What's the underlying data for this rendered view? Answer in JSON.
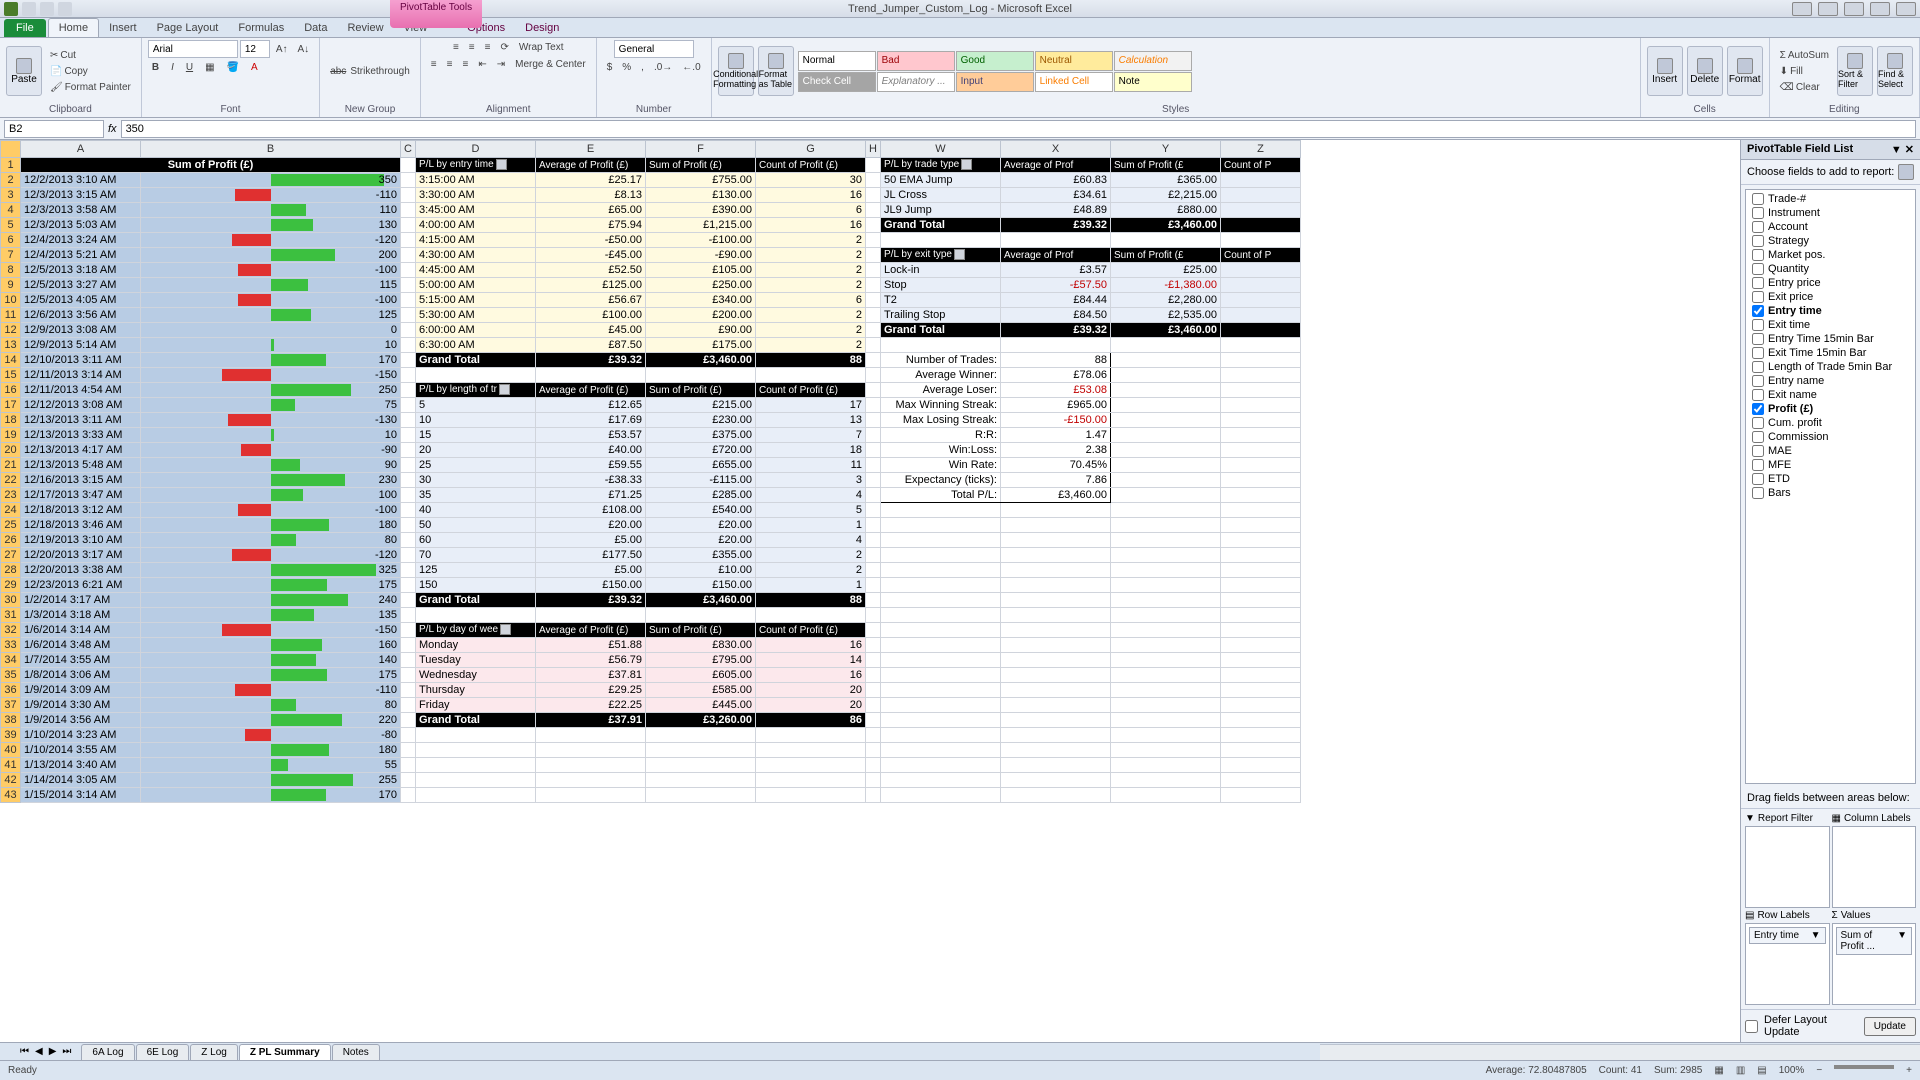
{
  "title": "Trend_Jumper_Custom_Log - Microsoft Excel",
  "tabtools": {
    "group": "PivotTable Tools",
    "designTab": "Design",
    "optionsTab": "Options"
  },
  "menu": {
    "file": "File",
    "home": "Home",
    "insert": "Insert",
    "pagelayout": "Page Layout",
    "formulas": "Formulas",
    "data": "Data",
    "review": "Review",
    "view": "View",
    "options": "Options",
    "design": "Design"
  },
  "ribbon": {
    "clipboard": {
      "label": "Clipboard",
      "paste": "Paste",
      "cut": "Cut",
      "copy": "Copy",
      "painter": "Format Painter"
    },
    "font": {
      "label": "Font",
      "name": "Arial",
      "size": "12"
    },
    "newgroup": {
      "label": "New Group",
      "strike": "Strikethrough"
    },
    "alignment": {
      "label": "Alignment",
      "wrap": "Wrap Text",
      "merge": "Merge & Center"
    },
    "number": {
      "label": "Number",
      "fmt": "General"
    },
    "styles": {
      "label": "Styles",
      "cond": "Conditional Formatting",
      "table": "Format as Table",
      "normal": "Normal",
      "bad": "Bad",
      "good": "Good",
      "neutral": "Neutral",
      "calc": "Calculation",
      "check": "Check Cell",
      "expl": "Explanatory ...",
      "input": "Input",
      "linked": "Linked Cell",
      "note": "Note"
    },
    "cells": {
      "label": "Cells",
      "insert": "Insert",
      "delete": "Delete",
      "format": "Format"
    },
    "editing": {
      "label": "Editing",
      "autosum": "AutoSum",
      "fill": "Fill",
      "clear": "Clear",
      "sort": "Sort & Filter",
      "find": "Find & Select"
    }
  },
  "nameBox": "B2",
  "formula": "350",
  "cols": [
    "A",
    "B",
    "C",
    "D",
    "E",
    "F",
    "G",
    "H",
    "W",
    "X",
    "Y",
    "Z"
  ],
  "sumProfitHeader": "Sum of Profit (£)",
  "profitRows": [
    {
      "r": 2,
      "date": "12/2/2013 3:10 AM",
      "v": 350
    },
    {
      "r": 3,
      "date": "12/3/2013 3:15 AM",
      "v": -110
    },
    {
      "r": 4,
      "date": "12/3/2013 3:58 AM",
      "v": 110
    },
    {
      "r": 5,
      "date": "12/3/2013 5:03 AM",
      "v": 130
    },
    {
      "r": 6,
      "date": "12/4/2013 3:24 AM",
      "v": -120
    },
    {
      "r": 7,
      "date": "12/4/2013 5:21 AM",
      "v": 200
    },
    {
      "r": 8,
      "date": "12/5/2013 3:18 AM",
      "v": -100
    },
    {
      "r": 9,
      "date": "12/5/2013 3:27 AM",
      "v": 115
    },
    {
      "r": 10,
      "date": "12/5/2013 4:05 AM",
      "v": -100
    },
    {
      "r": 11,
      "date": "12/6/2013 3:56 AM",
      "v": 125
    },
    {
      "r": 12,
      "date": "12/9/2013 3:08 AM",
      "v": 0
    },
    {
      "r": 13,
      "date": "12/9/2013 5:14 AM",
      "v": 10
    },
    {
      "r": 14,
      "date": "12/10/2013 3:11 AM",
      "v": 170
    },
    {
      "r": 15,
      "date": "12/11/2013 3:14 AM",
      "v": -150
    },
    {
      "r": 16,
      "date": "12/11/2013 4:54 AM",
      "v": 250
    },
    {
      "r": 17,
      "date": "12/12/2013 3:08 AM",
      "v": 75
    },
    {
      "r": 18,
      "date": "12/13/2013 3:11 AM",
      "v": -130
    },
    {
      "r": 19,
      "date": "12/13/2013 3:33 AM",
      "v": 10
    },
    {
      "r": 20,
      "date": "12/13/2013 4:17 AM",
      "v": -90
    },
    {
      "r": 21,
      "date": "12/13/2013 5:48 AM",
      "v": 90
    },
    {
      "r": 22,
      "date": "12/16/2013 3:15 AM",
      "v": 230
    },
    {
      "r": 23,
      "date": "12/17/2013 3:47 AM",
      "v": 100
    },
    {
      "r": 24,
      "date": "12/18/2013 3:12 AM",
      "v": -100
    },
    {
      "r": 25,
      "date": "12/18/2013 3:46 AM",
      "v": 180
    },
    {
      "r": 26,
      "date": "12/19/2013 3:10 AM",
      "v": 80
    },
    {
      "r": 27,
      "date": "12/20/2013 3:17 AM",
      "v": -120
    },
    {
      "r": 28,
      "date": "12/20/2013 3:38 AM",
      "v": 325
    },
    {
      "r": 29,
      "date": "12/23/2013 6:21 AM",
      "v": 175
    },
    {
      "r": 30,
      "date": "1/2/2014 3:17 AM",
      "v": 240
    },
    {
      "r": 31,
      "date": "1/3/2014 3:18 AM",
      "v": 135
    },
    {
      "r": 32,
      "date": "1/6/2014 3:14 AM",
      "v": -150
    },
    {
      "r": 33,
      "date": "1/6/2014 3:48 AM",
      "v": 160
    },
    {
      "r": 34,
      "date": "1/7/2014 3:55 AM",
      "v": 140
    },
    {
      "r": 35,
      "date": "1/8/2014 3:06 AM",
      "v": 175
    },
    {
      "r": 36,
      "date": "1/9/2014 3:09 AM",
      "v": -110
    },
    {
      "r": 37,
      "date": "1/9/2014 3:30 AM",
      "v": 80
    },
    {
      "r": 38,
      "date": "1/9/2014 3:56 AM",
      "v": 220
    },
    {
      "r": 39,
      "date": "1/10/2014 3:23 AM",
      "v": -80
    },
    {
      "r": 40,
      "date": "1/10/2014 3:55 AM",
      "v": 180
    },
    {
      "r": 41,
      "date": "1/13/2014 3:40 AM",
      "v": 55
    },
    {
      "r": 42,
      "date": "1/14/2014 3:05 AM",
      "v": 255
    },
    {
      "r": 43,
      "date": "1/15/2014 3:14 AM",
      "v": 170
    }
  ],
  "chart_data": {
    "type": "bar",
    "title": "Sum of Profit (£)",
    "categories": [
      "12/2/2013 3:10 AM",
      "12/3/2013 3:15 AM",
      "12/3/2013 3:58 AM",
      "12/3/2013 5:03 AM",
      "12/4/2013 3:24 AM",
      "12/4/2013 5:21 AM",
      "12/5/2013 3:18 AM",
      "12/5/2013 3:27 AM",
      "12/5/2013 4:05 AM",
      "12/6/2013 3:56 AM",
      "12/9/2013 3:08 AM",
      "12/9/2013 5:14 AM",
      "12/10/2013 3:11 AM",
      "12/11/2013 3:14 AM",
      "12/11/2013 4:54 AM",
      "12/12/2013 3:08 AM",
      "12/13/2013 3:11 AM",
      "12/13/2013 3:33 AM",
      "12/13/2013 4:17 AM",
      "12/13/2013 5:48 AM",
      "12/16/2013 3:15 AM",
      "12/17/2013 3:47 AM",
      "12/18/2013 3:12 AM",
      "12/18/2013 3:46 AM",
      "12/19/2013 3:10 AM",
      "12/20/2013 3:17 AM",
      "12/20/2013 3:38 AM",
      "12/23/2013 6:21 AM",
      "1/2/2014 3:17 AM",
      "1/3/2014 3:18 AM",
      "1/6/2014 3:14 AM",
      "1/6/2014 3:48 AM",
      "1/7/2014 3:55 AM",
      "1/8/2014 3:06 AM",
      "1/9/2014 3:09 AM",
      "1/9/2014 3:30 AM",
      "1/9/2014 3:56 AM",
      "1/10/2014 3:23 AM",
      "1/10/2014 3:55 AM",
      "1/13/2014 3:40 AM",
      "1/14/2014 3:05 AM",
      "1/15/2014 3:14 AM"
    ],
    "values": [
      350,
      -110,
      110,
      130,
      -120,
      200,
      -100,
      115,
      -100,
      125,
      0,
      10,
      170,
      -150,
      250,
      75,
      -130,
      10,
      -90,
      90,
      230,
      100,
      -100,
      180,
      80,
      -120,
      325,
      175,
      240,
      135,
      -150,
      160,
      140,
      175,
      -110,
      80,
      220,
      -80,
      180,
      55,
      255,
      170
    ],
    "xlabel": "",
    "ylabel": "Profit (£)",
    "ylim": [
      -200,
      400
    ]
  },
  "pivots": {
    "entryTime": {
      "title": "P/L by entry time",
      "cols": [
        "Average of Profit (£)",
        "Sum of Profit (£)",
        "Count of Profit (£)"
      ],
      "rows": [
        [
          "3:15:00 AM",
          "£25.17",
          "£755.00",
          "30"
        ],
        [
          "3:30:00 AM",
          "£8.13",
          "£130.00",
          "16"
        ],
        [
          "3:45:00 AM",
          "£65.00",
          "£390.00",
          "6"
        ],
        [
          "4:00:00 AM",
          "£75.94",
          "£1,215.00",
          "16"
        ],
        [
          "4:15:00 AM",
          "-£50.00",
          "-£100.00",
          "2"
        ],
        [
          "4:30:00 AM",
          "-£45.00",
          "-£90.00",
          "2"
        ],
        [
          "4:45:00 AM",
          "£52.50",
          "£105.00",
          "2"
        ],
        [
          "5:00:00 AM",
          "£125.00",
          "£250.00",
          "2"
        ],
        [
          "5:15:00 AM",
          "£56.67",
          "£340.00",
          "6"
        ],
        [
          "5:30:00 AM",
          "£100.00",
          "£200.00",
          "2"
        ],
        [
          "6:00:00 AM",
          "£45.00",
          "£90.00",
          "2"
        ],
        [
          "6:30:00 AM",
          "£87.50",
          "£175.00",
          "2"
        ]
      ],
      "grand": [
        "Grand Total",
        "£39.32",
        "£3,460.00",
        "88"
      ]
    },
    "length": {
      "title": "P/L by length of tr",
      "cols": [
        "Average of Profit (£)",
        "Sum of Profit (£)",
        "Count of Profit (£)"
      ],
      "rows": [
        [
          "5",
          "£12.65",
          "£215.00",
          "17"
        ],
        [
          "10",
          "£17.69",
          "£230.00",
          "13"
        ],
        [
          "15",
          "£53.57",
          "£375.00",
          "7"
        ],
        [
          "20",
          "£40.00",
          "£720.00",
          "18"
        ],
        [
          "25",
          "£59.55",
          "£655.00",
          "11"
        ],
        [
          "30",
          "-£38.33",
          "-£115.00",
          "3"
        ],
        [
          "35",
          "£71.25",
          "£285.00",
          "4"
        ],
        [
          "40",
          "£108.00",
          "£540.00",
          "5"
        ],
        [
          "50",
          "£20.00",
          "£20.00",
          "1"
        ],
        [
          "60",
          "£5.00",
          "£20.00",
          "4"
        ],
        [
          "70",
          "£177.50",
          "£355.00",
          "2"
        ],
        [
          "125",
          "£5.00",
          "£10.00",
          "2"
        ],
        [
          "150",
          "£150.00",
          "£150.00",
          "1"
        ]
      ],
      "grand": [
        "Grand Total",
        "£39.32",
        "£3,460.00",
        "88"
      ]
    },
    "dayWeek": {
      "title": "P/L by day of wee",
      "cols": [
        "Average of Profit (£)",
        "Sum of Profit (£)",
        "Count of Profit (£)"
      ],
      "rows": [
        [
          "Monday",
          "£51.88",
          "£830.00",
          "16"
        ],
        [
          "Tuesday",
          "£56.79",
          "£795.00",
          "14"
        ],
        [
          "Wednesday",
          "£37.81",
          "£605.00",
          "16"
        ],
        [
          "Thursday",
          "£29.25",
          "£585.00",
          "20"
        ],
        [
          "Friday",
          "£22.25",
          "£445.00",
          "20"
        ]
      ],
      "grand": [
        "Grand Total",
        "£37.91",
        "£3,260.00",
        "86"
      ]
    },
    "tradeType": {
      "title": "P/L by trade type",
      "cols": [
        "Average of Prof",
        "Sum of Profit (£",
        "Count of P"
      ],
      "rows": [
        [
          "50 EMA Jump",
          "£60.83",
          "£365.00",
          ""
        ],
        [
          "JL Cross",
          "£34.61",
          "£2,215.00",
          ""
        ],
        [
          "JL9 Jump",
          "£48.89",
          "£880.00",
          ""
        ]
      ],
      "grand": [
        "Grand Total",
        "£39.32",
        "£3,460.00",
        ""
      ]
    },
    "exitType": {
      "title": "P/L by exit type",
      "cols": [
        "Average of Prof",
        "Sum of Profit (£",
        "Count of P"
      ],
      "rows": [
        [
          "Lock-in",
          "£3.57",
          "£25.00",
          ""
        ],
        [
          "Stop",
          "-£57.50",
          "-£1,380.00",
          ""
        ],
        [
          "T2",
          "£84.44",
          "£2,280.00",
          ""
        ],
        [
          "Trailing Stop",
          "£84.50",
          "£2,535.00",
          ""
        ]
      ],
      "grand": [
        "Grand Total",
        "£39.32",
        "£3,460.00",
        ""
      ]
    }
  },
  "stats": [
    [
      "Number of Trades:",
      "88"
    ],
    [
      "Average Winner:",
      "£78.06"
    ],
    [
      "Average Loser:",
      "£53.08"
    ],
    [
      "Max Winning Streak:",
      "£965.00"
    ],
    [
      "Max Losing Streak:",
      "-£150.00"
    ],
    [
      "R:R:",
      "1.47"
    ],
    [
      "Win:Loss:",
      "2.38"
    ],
    [
      "Win Rate:",
      "70.45%"
    ],
    [
      "Expectancy (ticks):",
      "7.86"
    ],
    [
      "Total P/L:",
      "£3,460.00"
    ]
  ],
  "fieldList": {
    "title": "PivotTable Field List",
    "choose": "Choose fields to add to report:",
    "fields": [
      {
        "n": "Trade-#",
        "c": false
      },
      {
        "n": "Instrument",
        "c": false
      },
      {
        "n": "Account",
        "c": false
      },
      {
        "n": "Strategy",
        "c": false
      },
      {
        "n": "Market pos.",
        "c": false
      },
      {
        "n": "Quantity",
        "c": false
      },
      {
        "n": "Entry price",
        "c": false
      },
      {
        "n": "Exit price",
        "c": false
      },
      {
        "n": "Entry time",
        "c": true
      },
      {
        "n": "Exit time",
        "c": false
      },
      {
        "n": "Entry Time 15min Bar",
        "c": false
      },
      {
        "n": "Exit Time 15min Bar",
        "c": false
      },
      {
        "n": "Length of Trade 5min Bar",
        "c": false
      },
      {
        "n": "Entry name",
        "c": false
      },
      {
        "n": "Exit name",
        "c": false
      },
      {
        "n": "Profit (£)",
        "c": true
      },
      {
        "n": "Cum. profit",
        "c": false
      },
      {
        "n": "Commission",
        "c": false
      },
      {
        "n": "MAE",
        "c": false
      },
      {
        "n": "MFE",
        "c": false
      },
      {
        "n": "ETD",
        "c": false
      },
      {
        "n": "Bars",
        "c": false
      }
    ],
    "dragLabel": "Drag fields between areas below:",
    "areas": {
      "reportFilter": "Report Filter",
      "columnLabels": "Column Labels",
      "rowLabels": "Row Labels",
      "values": "Values"
    },
    "rowItem": "Entry time",
    "valItem": "Sum of Profit ...",
    "defer": "Defer Layout Update",
    "update": "Update"
  },
  "sheetTabs": [
    "6A Log",
    "6E Log",
    "Z Log",
    "Z PL Summary",
    "Notes"
  ],
  "status": {
    "ready": "Ready",
    "avg": "Average: 72.80487805",
    "count": "Count: 41",
    "sum": "Sum: 2985",
    "zoom": "100%"
  }
}
